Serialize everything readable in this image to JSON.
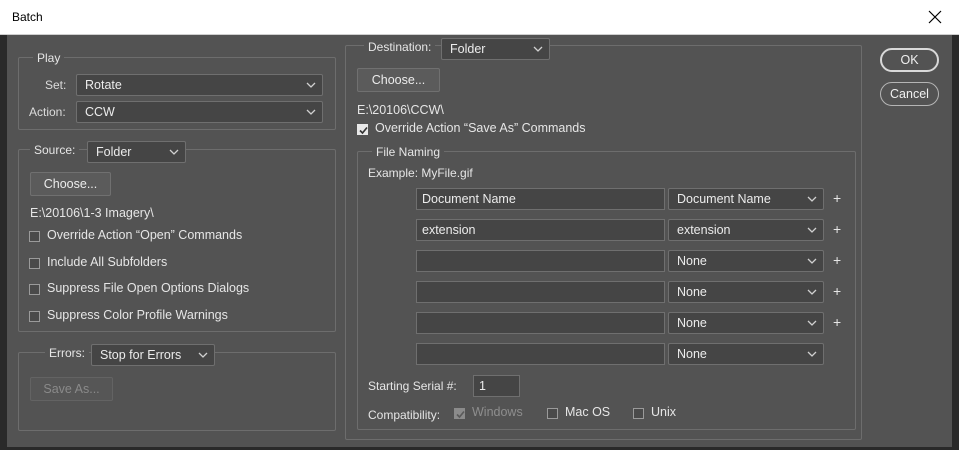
{
  "window": {
    "title": "Batch"
  },
  "buttons": {
    "ok": "OK",
    "cancel": "Cancel"
  },
  "play": {
    "legend": "Play",
    "set_label": "Set:",
    "set_value": "Rotate",
    "action_label": "Action:",
    "action_value": "CCW"
  },
  "source": {
    "label": "Source:",
    "value": "Folder",
    "choose": "Choose...",
    "path": "E:\\20106\\1-3 Imagery\\",
    "options": [
      {
        "label": "Override Action “Open” Commands",
        "checked": false
      },
      {
        "label": "Include All Subfolders",
        "checked": false
      },
      {
        "label": "Suppress File Open Options Dialogs",
        "checked": false
      },
      {
        "label": "Suppress Color Profile Warnings",
        "checked": false
      }
    ]
  },
  "errors": {
    "label": "Errors:",
    "value": "Stop for Errors",
    "save_as": "Save As..."
  },
  "destination": {
    "label": "Destination:",
    "value": "Folder",
    "choose": "Choose...",
    "path": "E:\\20106\\CCW\\",
    "override_label": "Override Action “Save As” Commands",
    "override_checked": true
  },
  "file_naming": {
    "legend": "File Naming",
    "example": "Example: MyFile.gif",
    "rows": [
      {
        "text": "Document Name",
        "select": "Document Name",
        "plus": "+"
      },
      {
        "text": "extension",
        "select": "extension",
        "plus": "+"
      },
      {
        "text": "",
        "select": "None",
        "plus": "+"
      },
      {
        "text": "",
        "select": "None",
        "plus": "+"
      },
      {
        "text": "",
        "select": "None",
        "plus": "+"
      },
      {
        "text": "",
        "select": "None",
        "plus": ""
      }
    ],
    "serial_label": "Starting Serial #:",
    "serial_value": "1",
    "compat_label": "Compatibility:",
    "compat": [
      {
        "label": "Windows",
        "checked": true,
        "disabled": true
      },
      {
        "label": "Mac OS",
        "checked": false,
        "disabled": false
      },
      {
        "label": "Unix",
        "checked": false,
        "disabled": false
      }
    ]
  }
}
